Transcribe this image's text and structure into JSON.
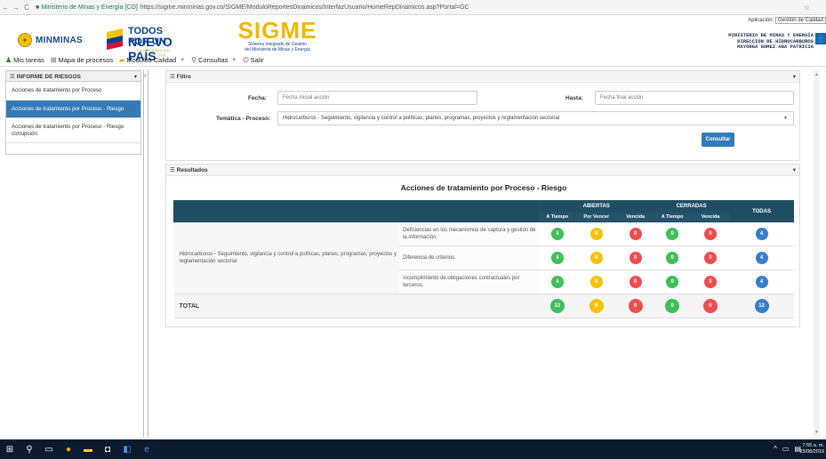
{
  "browser": {
    "back": "←",
    "forward": "→",
    "reload": "C",
    "site_name": "Ministerio de Minas y Energía [CO]",
    "url": "https://sigme.minminas.gov.co/SIGME/ModuloReportesDinamicos/InterfazUsuario/HomeRepDinamicos.asp?Portal=GC",
    "star": "☆"
  },
  "header": {
    "logo_minminas": "MINMINAS",
    "logo_tp_line1": "TODOS POR UN",
    "logo_tp_line2": "NUEVO PAÍS",
    "logo_tp_line3": "PAZ  EQUIDAD  EDUCACIÓN",
    "logo_sigme": "SIGME",
    "logo_sigme_sub1": "Sistema Integrado de Gestión",
    "logo_sigme_sub2": "del Ministerio de Minas y Energía",
    "app_label": "Aplicación:",
    "app_value": "Gestión de Calidad",
    "user_line1": "MINISTERIO DE MINAS Y ENERGÍA",
    "user_line2": "DIRECCION DE HIDROCARBUROS",
    "user_line3": "MAYORGA GOMEZ ANA PATRICIA"
  },
  "menu": {
    "items": [
      "Mis tareas",
      "Mapa de procesos",
      "Módulos Calidad",
      "Consultas",
      "Salir"
    ]
  },
  "sidebar": {
    "title": "INFORME DE RIESGOS",
    "items": [
      "Acciones de tratamiento por Proceso",
      "Acciones de tratamiento por Proceso - Riesgo",
      "Acciones de tratamiento por Proceso - Riesgo corrupción"
    ],
    "active_index": 1
  },
  "filtro": {
    "title": "Filtro",
    "fecha_label": "Fecha:",
    "fecha_placeholder": "Fecha inicial acción",
    "hasta_label": "Hasta:",
    "hasta_placeholder": "Fecha final acción",
    "tematica_label": "Temática - Proceso:",
    "tematica_value": "Hidrocarburos - Seguimiento, vigilancia y control a políticas, planes, programas, proyectos y reglamentación sectorial",
    "consultar": "Consultar"
  },
  "resultados": {
    "title": "Resultados",
    "report_title": "Acciones de tratamiento por Proceso - Riesgo",
    "headers": {
      "abiertas": "ABIERTAS",
      "cerradas": "CERRADAS",
      "todas": "TODAS",
      "a_tiempo": "A Tiempo",
      "por_vencer": "Por Vencer",
      "vencida": "Vencida",
      "c_a_tiempo": "A Tiempo",
      "c_vencida": "Vencida"
    },
    "process": "Hidrocarburos - Seguimiento, vigilancia y control a políticas, planes, programas, proyectos y reglamentación sectorial",
    "rows": [
      {
        "cause": "Deficiencias en los mecanismos de captura y gestión de la información.",
        "a": "4",
        "pv": "0",
        "v": "0",
        "ca": "0",
        "cv": "0",
        "t": "4"
      },
      {
        "cause": "Diferencia de criterios.",
        "a": "4",
        "pv": "0",
        "v": "0",
        "ca": "0",
        "cv": "0",
        "t": "4"
      },
      {
        "cause": "Incumplimiento de obligaciones contractuales por terceros.",
        "a": "4",
        "pv": "0",
        "v": "0",
        "ca": "0",
        "cv": "0",
        "t": "4"
      }
    ],
    "total": {
      "label": "TOTAL",
      "a": "12",
      "pv": "0",
      "v": "0",
      "ca": "0",
      "cv": "0",
      "t": "12"
    }
  },
  "taskbar": {
    "time": "7:55 a. m.",
    "date": "23/08/2019"
  },
  "colors": {
    "primary": "#337ab7",
    "header_dark": "#1f4e63",
    "green": "#3cbf5c",
    "yellow": "#f4c20d",
    "red": "#f04d4d",
    "blue": "#3a7dc9"
  }
}
